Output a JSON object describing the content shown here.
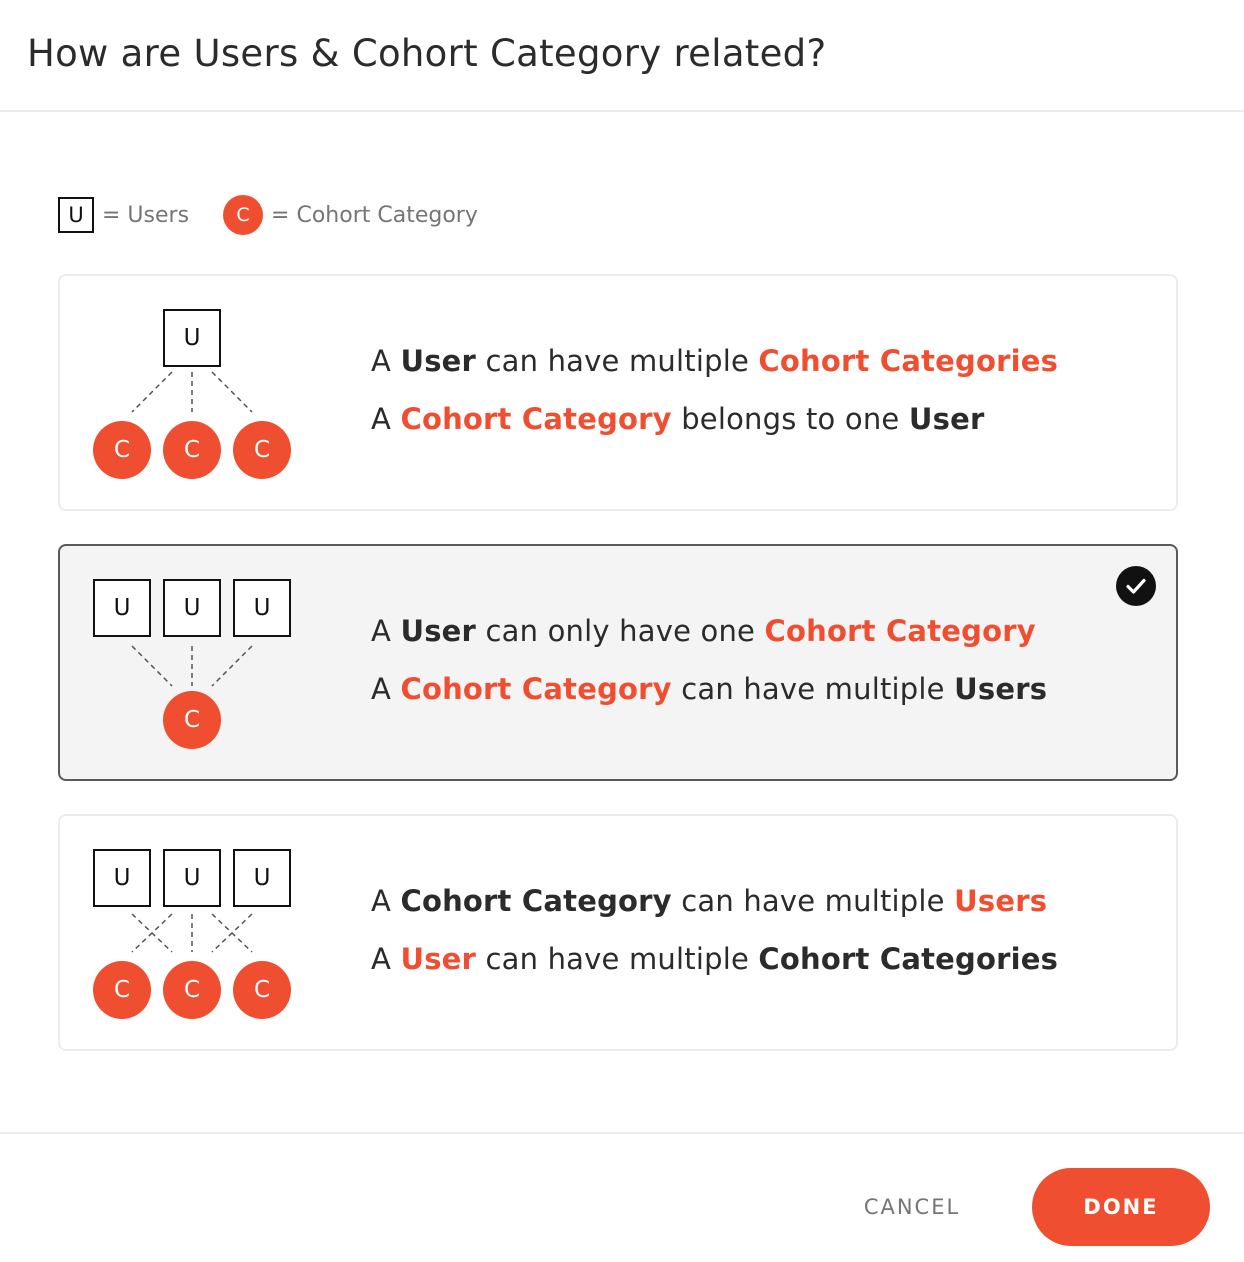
{
  "title": "How are Users & Cohort Category related?",
  "legend": {
    "user_symbol": "U",
    "user_text": "= Users",
    "cohort_symbol": "C",
    "cohort_text": "= Cohort Category"
  },
  "symbols": {
    "user": "U",
    "cohort": "C"
  },
  "colors": {
    "accent": "#f04e30",
    "selected_bg": "#f4f4f4",
    "selected_border": "#5a5a5a"
  },
  "options": [
    {
      "selected": false,
      "line1": [
        "A ",
        "User",
        " can have multiple ",
        "Cohort Categories"
      ],
      "line2": [
        "A ",
        "Cohort Category",
        " belongs to one ",
        "User"
      ]
    },
    {
      "selected": true,
      "line1": [
        "A ",
        "User",
        " can only have one ",
        "Cohort Category"
      ],
      "line2": [
        "A ",
        "Cohort Category",
        " can have multiple ",
        "Users"
      ]
    },
    {
      "selected": false,
      "line1": [
        "A ",
        "Cohort Category",
        " can have multiple ",
        "Users"
      ],
      "line2": [
        "A ",
        "User",
        " can have multiple ",
        "Cohort Categories"
      ]
    }
  ],
  "footer": {
    "cancel_label": "CANCEL",
    "done_label": "DONE"
  },
  "icons": {
    "selected_check": "check-circle-icon"
  }
}
